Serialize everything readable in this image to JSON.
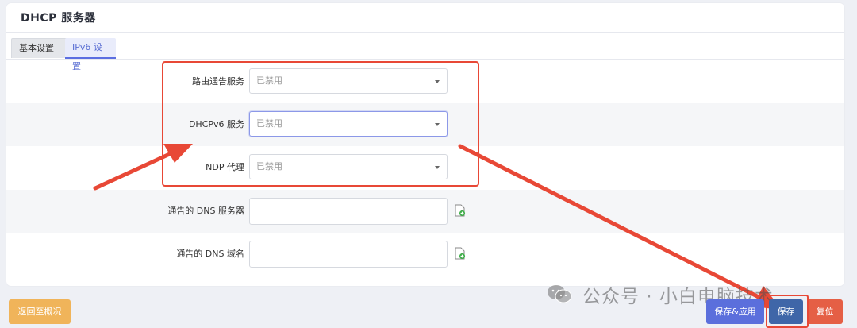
{
  "page": {
    "title": "DHCP 服务器"
  },
  "tabs": [
    {
      "label": "基本设置",
      "active": false
    },
    {
      "label": "IPv6 设置",
      "active": true
    }
  ],
  "fields": {
    "ra_service": {
      "label": "路由通告服务",
      "value": "已禁用"
    },
    "dhcpv6_service": {
      "label": "DHCPv6 服务",
      "value": "已禁用"
    },
    "ndp_proxy": {
      "label": "NDP 代理",
      "value": "已禁用"
    },
    "dns_servers": {
      "label": "通告的 DNS 服务器",
      "value": ""
    },
    "dns_domain": {
      "label": "通告的 DNS 域名",
      "value": ""
    }
  },
  "buttons": {
    "back": "返回至概况",
    "save_apply": "保存&应用",
    "save": "保存",
    "reset": "复位"
  },
  "watermark": "公众号 · 小白电脑技术",
  "colors": {
    "accent": "#5b6fdc",
    "annotation": "#e84836",
    "back_button": "#f0b45a",
    "save_button": "#3f66a8",
    "reset_button": "#e55f45"
  }
}
